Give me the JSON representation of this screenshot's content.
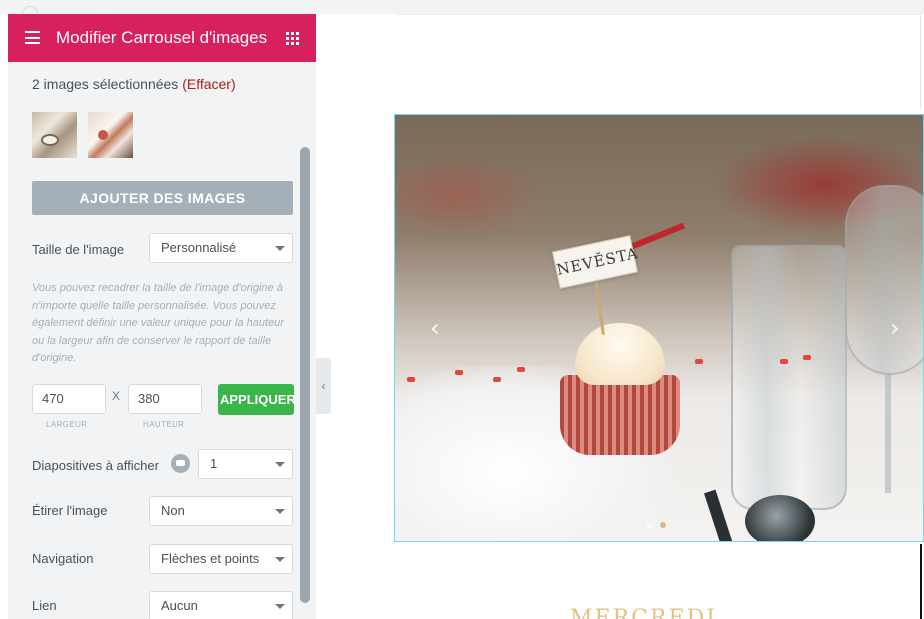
{
  "panel": {
    "title": "Modifier Carrousel d'images",
    "selection_text": "2 images sélectionnées",
    "clear_label": "(Effacer)",
    "add_images_label": "AJOUTER DES IMAGES",
    "image_size": {
      "label": "Taille de l'image",
      "value": "Personnalisé",
      "description": "Vous pouvez recadrer la taille de l'image d'origine à n'importe quelle taille personnalisée. Vous pouvez également définir une valeur unique pour la hauteur ou la largeur afin de conserver le rapport de taille d'origine."
    },
    "custom_size": {
      "width_value": "470",
      "height_value": "380",
      "separator": "X",
      "apply_label": "APPLIQUER",
      "width_caption": "LARGEUR",
      "height_caption": "HAUTEUR"
    },
    "slides_to_show": {
      "label": "Diapositives à afficher",
      "value": "1"
    },
    "stretch_image": {
      "label": "Étirer l'image",
      "value": "Non"
    },
    "navigation": {
      "label": "Navigation",
      "value": "Flèches et points"
    },
    "link": {
      "label": "Lien",
      "value": "Aucun"
    }
  },
  "preview": {
    "photo_tag_text": "NEVĚSTA",
    "heading": "MERCREDI"
  },
  "icons": {
    "menu": "hamburger-icon",
    "widgets": "grid-icon",
    "collapse": "chevron-left-icon",
    "info": "info-icon",
    "prev": "chevron-left-icon",
    "next": "chevron-right-icon"
  },
  "colors": {
    "header": "#d6205f",
    "apply": "#39b54a",
    "add_button": "#a4afb7",
    "clear_link": "#b01b1b",
    "heading_gold": "#e1c484"
  }
}
